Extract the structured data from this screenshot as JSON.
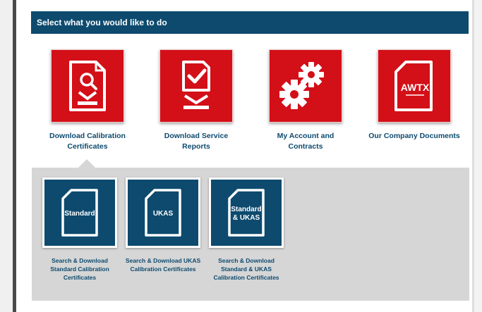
{
  "header": {
    "title": "Select what you would like to do"
  },
  "options": [
    {
      "label": "Download Calibration Certificates",
      "icon": "search-document-download-icon"
    },
    {
      "label": "Download Service Reports",
      "icon": "checked-document-download-icon"
    },
    {
      "label": "My Account and Contracts",
      "icon": "gears-icon"
    },
    {
      "label": "Our Company Documents",
      "icon": "awtx-document-icon",
      "icon_text": "AWTX"
    }
  ],
  "sub_options": [
    {
      "tile_text": "Standard",
      "label": "Search & Download Standard Calibration Certificates"
    },
    {
      "tile_text": "UKAS",
      "label": "Search & Download UKAS Calibration Certificates"
    },
    {
      "tile_text_line1": "Standard",
      "tile_text_line2": "& UKAS",
      "label": "Search & Download Standard & UKAS Calibration Certificates"
    }
  ],
  "colors": {
    "header": "#0d4a6e",
    "tile_red": "#d30f18",
    "tile_blue": "#0d4a6e",
    "panel_gray": "#d6d6d6"
  }
}
